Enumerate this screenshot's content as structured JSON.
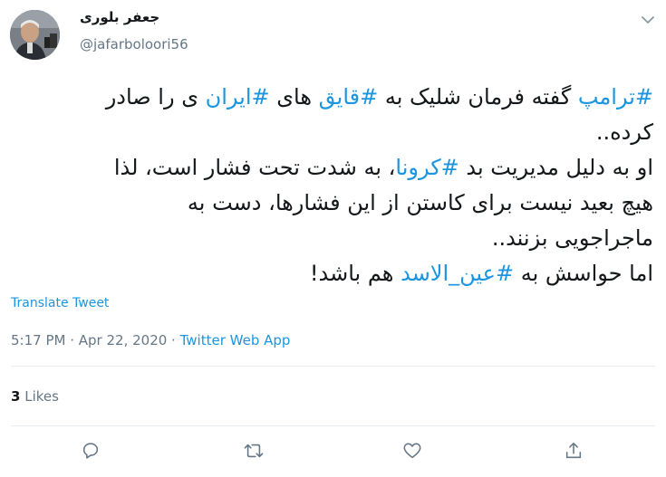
{
  "user": {
    "display_name": "جعفر بلوری",
    "handle": "@jafarboloori56"
  },
  "tweet": {
    "line1": {
      "t1": "#ترامپ",
      "t2": " گفته فرمان شلیک به ",
      "t3": "#قایق",
      "t4": " های ",
      "t5": "#ایران",
      "t6": " ی را صادر"
    },
    "line2": "کرده..",
    "line3": {
      "t1": "او به دلیل مدیریت بد ",
      "t2": "#کرونا",
      "t3": "، به شدت تحت فشار است، لذا"
    },
    "line4": "هیچ بعید نیست برای کاستن از این فشارها، دست به",
    "line5": "ماجراجویی بزنند..",
    "line6": {
      "t1": "اما حواسش به ",
      "t2": "#عین_الاسد",
      "t3": " هم باشد!"
    }
  },
  "translate_label": "Translate Tweet",
  "meta": {
    "time": "5:17 PM",
    "separator": " · ",
    "date": "Apr 22, 2020",
    "source": "Twitter Web App"
  },
  "likes": {
    "count": "3",
    "label": " Likes"
  },
  "icons": {
    "chevron": "chevron-down-icon",
    "reply": "reply-icon",
    "retweet": "retweet-icon",
    "like": "like-icon",
    "share": "share-icon"
  },
  "colors": {
    "link": "#1b95e0",
    "muted": "#657786",
    "text": "#14171a",
    "divider": "#e6ecf0"
  }
}
